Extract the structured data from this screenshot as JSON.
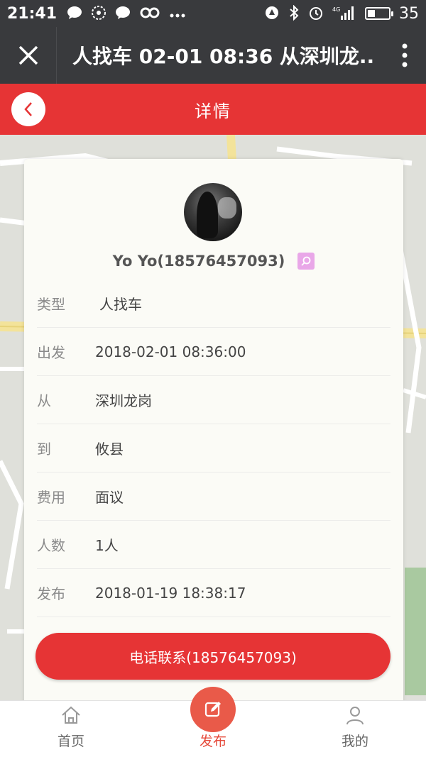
{
  "status_bar": {
    "time": "21:41",
    "battery": "35",
    "battery_level": 0.35,
    "network": "4G",
    "left_icons": [
      "message-icon",
      "wechat-icon",
      "chat-icon",
      "infinity-icon",
      "more-dots-icon"
    ],
    "right_icons": [
      "signal-app-icon",
      "bluetooth-icon",
      "alarm-icon",
      "signal-4g-icon",
      "battery-icon"
    ]
  },
  "titlebar": {
    "title": "人找车 02-01 08:36 从深圳龙..",
    "close_icon": "close-icon",
    "more_icon": "more-vertical-icon"
  },
  "header": {
    "title": "详情",
    "back_icon": "chevron-left-icon"
  },
  "profile": {
    "name": "Yo Yo(18576457093)",
    "badge_icon": "search-icon"
  },
  "details": [
    {
      "label": "类型",
      "value": "人找车"
    },
    {
      "label": "出发",
      "value": "2018-02-01 08:36:00"
    },
    {
      "label": "从",
      "value": "深圳龙岗"
    },
    {
      "label": "到",
      "value": "攸县"
    },
    {
      "label": "费用",
      "value": "面议"
    },
    {
      "label": "人数",
      "value": "1人"
    },
    {
      "label": "发布",
      "value": "2018-01-19 18:38:17"
    }
  ],
  "call_button": "电话联系(18576457093)",
  "bottom_nav": [
    {
      "label": "首页",
      "icon": "home-icon"
    },
    {
      "label": "发布",
      "icon": "edit-icon"
    },
    {
      "label": "我的",
      "icon": "user-icon"
    }
  ],
  "colors": {
    "accent": "#e63435",
    "topbar": "#393a3d",
    "post": "#e95a49"
  }
}
